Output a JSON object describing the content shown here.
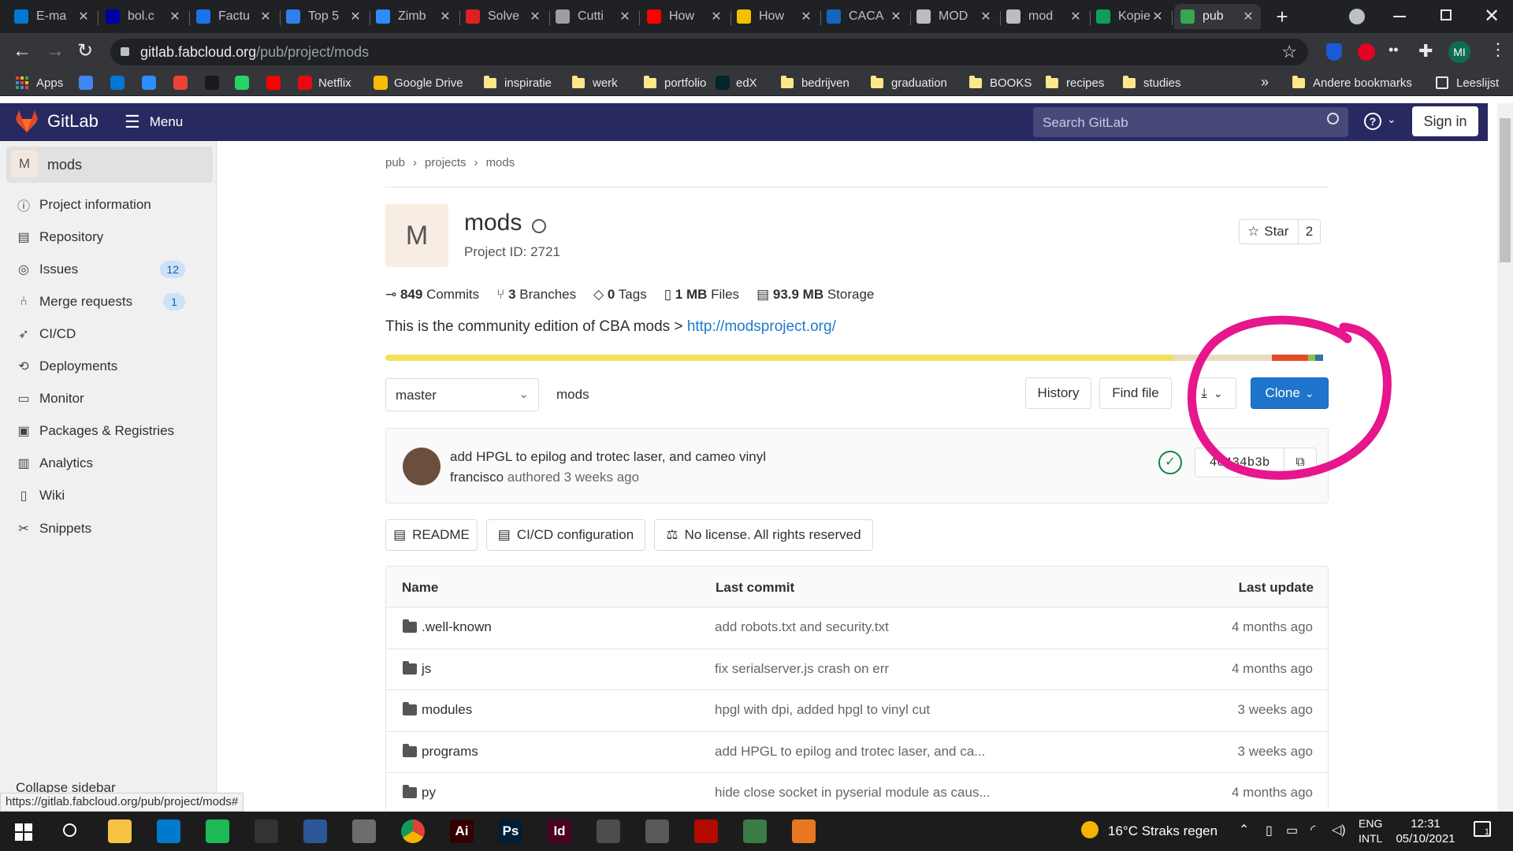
{
  "browser": {
    "tabs": [
      {
        "title": "E-ma",
        "color": "#0078d4"
      },
      {
        "title": "bol.c",
        "color": "#0000a4"
      },
      {
        "title": "Factu",
        "color": "#1a73e8"
      },
      {
        "title": "Top 5",
        "color": "#2f80ed"
      },
      {
        "title": "Zimb",
        "color": "#2d8cff"
      },
      {
        "title": "Solve",
        "color": "#e02020"
      },
      {
        "title": "Cutti",
        "color": "#9e9e9e"
      },
      {
        "title": "How",
        "color": "#ff0000"
      },
      {
        "title": "How",
        "color": "#f2c200"
      },
      {
        "title": "CACA",
        "color": "#1565c0"
      },
      {
        "title": "MOD",
        "color": "#bdbdbd"
      },
      {
        "title": "mod",
        "color": "#bdbdbd"
      },
      {
        "title": "Kopie",
        "color": "#0f9d58"
      },
      {
        "title": "pub",
        "color": "#34a853"
      }
    ],
    "new_tab": "+",
    "url_host": "gitlab.fabcloud.org",
    "url_path": "/pub/project/mods",
    "profile": "MI",
    "bookmarks": [
      {
        "label": "Apps",
        "kind": "apps"
      },
      {
        "label": "",
        "kind": "icon",
        "color": "#4285f4"
      },
      {
        "label": "",
        "kind": "icon",
        "color": "#0078d4"
      },
      {
        "label": "",
        "kind": "icon",
        "color": "#2d8cff"
      },
      {
        "label": "",
        "kind": "icon",
        "color": "#ea4335"
      },
      {
        "label": "",
        "kind": "icon",
        "color": "#1a1a1a"
      },
      {
        "label": "",
        "kind": "icon",
        "color": "#25d366"
      },
      {
        "label": "",
        "kind": "icon",
        "color": "#ff0000"
      },
      {
        "label": "Netflix",
        "kind": "icon",
        "color": "#e50914"
      },
      {
        "label": "Google Drive",
        "kind": "icon",
        "color": "#fbbc04"
      },
      {
        "label": "inspiratie",
        "kind": "folder"
      },
      {
        "label": "werk",
        "kind": "folder"
      },
      {
        "label": "portfolio",
        "kind": "folder"
      },
      {
        "label": "edX",
        "kind": "icon",
        "color": "#02262b"
      },
      {
        "label": "bedrijven",
        "kind": "folder"
      },
      {
        "label": "graduation",
        "kind": "folder"
      },
      {
        "label": "BOOKS",
        "kind": "folder"
      },
      {
        "label": "recipes",
        "kind": "folder"
      },
      {
        "label": "studies",
        "kind": "folder"
      }
    ],
    "bookmarks_more": "»",
    "other_bookmarks": "Andere bookmarks",
    "reading_list": "Leeslijst",
    "status_url": "https://gitlab.fabcloud.org/pub/project/mods#"
  },
  "gitlab": {
    "brand": "GitLab",
    "menu": "Menu",
    "search_placeholder": "Search GitLab",
    "sign_in": "Sign in",
    "sidebar": {
      "project_initial": "M",
      "project_name": "mods",
      "items": [
        {
          "label": "Project information",
          "icon": "info"
        },
        {
          "label": "Repository",
          "icon": "doc"
        },
        {
          "label": "Issues",
          "icon": "issues",
          "badge": "12"
        },
        {
          "label": "Merge requests",
          "icon": "merge",
          "badge": "1"
        },
        {
          "label": "CI/CD",
          "icon": "rocket"
        },
        {
          "label": "Deployments",
          "icon": "deploy"
        },
        {
          "label": "Monitor",
          "icon": "monitor"
        },
        {
          "label": "Packages & Registries",
          "icon": "package"
        },
        {
          "label": "Analytics",
          "icon": "chart"
        },
        {
          "label": "Wiki",
          "icon": "book"
        },
        {
          "label": "Snippets",
          "icon": "scissors"
        }
      ],
      "collapse": "Collapse sidebar"
    },
    "breadcrumb": [
      "pub",
      "projects",
      "mods"
    ],
    "project": {
      "initial": "M",
      "name": "mods",
      "id_text": "Project ID: 2721",
      "star_label": "Star",
      "star_count": "2",
      "stats": [
        {
          "value": "849",
          "label": "Commits"
        },
        {
          "value": "3",
          "label": "Branches"
        },
        {
          "value": "0",
          "label": "Tags"
        },
        {
          "value": "1 MB",
          "label": "Files"
        },
        {
          "value": "93.9 MB",
          "label": "Storage"
        }
      ],
      "description": "This is the community edition of CBA mods >",
      "description_link": "http://modsproject.org/"
    },
    "language_bar": [
      {
        "fraction": 0.835,
        "color": "#f1e05a"
      },
      {
        "fraction": 0.105,
        "color": "#e8dcc0"
      },
      {
        "fraction": 0.038,
        "color": "#e34c26"
      },
      {
        "fraction": 0.008,
        "color": "#8bc34a"
      },
      {
        "fraction": 0.008,
        "color": "#3572a5"
      }
    ],
    "repo_bar": {
      "branch": "master",
      "path": "mods",
      "history": "History",
      "find_file": "Find file",
      "clone": "Clone"
    },
    "last_commit": {
      "message": "add HPGL to epilog and trotec laser, and cameo vinyl",
      "author": "francisco",
      "authored": "authored 3 weeks ago",
      "sha": "4c434b3b"
    },
    "badges": [
      "README",
      "CI/CD configuration",
      "No license. All rights reserved"
    ],
    "table": {
      "headers": [
        "Name",
        "Last commit",
        "Last update"
      ],
      "rows": [
        {
          "name": ".well-known",
          "commit": "add robots.txt and security.txt",
          "updated": "4 months ago"
        },
        {
          "name": "js",
          "commit": "fix serialserver.js crash on err",
          "updated": "4 months ago"
        },
        {
          "name": "modules",
          "commit": "hpgl with dpi, added hpgl to vinyl cut",
          "updated": "3 weeks ago"
        },
        {
          "name": "programs",
          "commit": "add HPGL to epilog and trotec laser, and ca...",
          "updated": "3 weeks ago"
        },
        {
          "name": "py",
          "commit": "hide close socket in pyserial module as caus...",
          "updated": "4 months ago"
        }
      ]
    }
  },
  "taskbar": {
    "apps": [
      {
        "name": "file-explorer",
        "color": "#f5c242",
        "glyph": ""
      },
      {
        "name": "vscode",
        "color": "#007acc",
        "glyph": ""
      },
      {
        "name": "spotify",
        "color": "#1db954",
        "glyph": ""
      },
      {
        "name": "notepad",
        "color": "#333333",
        "glyph": ""
      },
      {
        "name": "powershell",
        "color": "#2b5797",
        "glyph": ""
      },
      {
        "name": "photos",
        "color": "#6d6d6d",
        "glyph": ""
      },
      {
        "name": "chrome",
        "color": "#db4437",
        "glyph": ""
      },
      {
        "name": "illustrator",
        "color": "#330000",
        "glyph": "Ai"
      },
      {
        "name": "photoshop",
        "color": "#001e36",
        "glyph": "Ps"
      },
      {
        "name": "indesign",
        "color": "#49021f",
        "glyph": "Id"
      },
      {
        "name": "calculator",
        "color": "#4c4c4c",
        "glyph": ""
      },
      {
        "name": "app-12",
        "color": "#5a5a5a",
        "glyph": ""
      },
      {
        "name": "acrobat",
        "color": "#b30b00",
        "glyph": ""
      },
      {
        "name": "app-14",
        "color": "#3a7d44",
        "glyph": ""
      },
      {
        "name": "app-15",
        "color": "#e87722",
        "glyph": ""
      },
      {
        "name": "settings",
        "color": "#1c1c1c",
        "glyph": ""
      }
    ],
    "weather": "16°C  Straks regen",
    "lang_top": "ENG",
    "lang_bottom": "INTL",
    "time": "12:31",
    "date": "05/10/2021",
    "notifications": "1"
  }
}
